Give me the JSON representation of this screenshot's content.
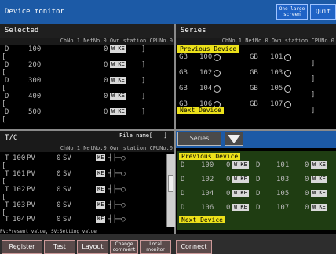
{
  "window": {
    "title": "Device monitor",
    "one_large_screen": "One large screen",
    "quit": "Quit"
  },
  "panels": {
    "selected": {
      "title": "Selected",
      "column_header": "ChNo.1 NetNo.0 Own station CPUNo.0",
      "rows": [
        {
          "dev": "D",
          "addr": "100",
          "val": "0",
          "badge": "W KE"
        },
        {
          "dev": "D",
          "addr": "200",
          "val": "0",
          "badge": "W KE"
        },
        {
          "dev": "D",
          "addr": "300",
          "val": "0",
          "badge": "W KE"
        },
        {
          "dev": "D",
          "addr": "400",
          "val": "0",
          "badge": "W KE"
        },
        {
          "dev": "D",
          "addr": "500",
          "val": "0",
          "badge": "W KE"
        }
      ]
    },
    "series": {
      "title": "Series",
      "column_header": "ChNo.1 NetNo.0 Own station CPUNo.0",
      "prev": "Previous Device",
      "next": "Next Device",
      "rows": [
        {
          "left_dev": "GB",
          "left_addr": "100",
          "right_dev": "GB",
          "right_addr": "101"
        },
        {
          "left_dev": "GB",
          "left_addr": "102",
          "right_dev": "GB",
          "right_addr": "103"
        },
        {
          "left_dev": "GB",
          "left_addr": "104",
          "right_dev": "GB",
          "right_addr": "105"
        },
        {
          "left_dev": "GB",
          "left_addr": "106",
          "right_dev": "GB",
          "right_addr": "107"
        }
      ]
    },
    "tc": {
      "title": "T/C",
      "file_name_label": "File name[",
      "column_header": "ChNo.1 NetNo.0 Own station CPUNo.0",
      "rows": [
        {
          "dev": "T",
          "addr": "100",
          "pv": "PV",
          "val": "0",
          "sv": "SV",
          "badge": "KE"
        },
        {
          "dev": "T",
          "addr": "101",
          "pv": "PV",
          "val": "0",
          "sv": "SV",
          "badge": "KE"
        },
        {
          "dev": "T",
          "addr": "102",
          "pv": "PV",
          "val": "0",
          "sv": "SV",
          "badge": "KE"
        },
        {
          "dev": "T",
          "addr": "103",
          "pv": "PV",
          "val": "0",
          "sv": "SV",
          "badge": "KE"
        },
        {
          "dev": "T",
          "addr": "104",
          "pv": "PV",
          "val": "0",
          "sv": "SV",
          "badge": "KE"
        }
      ],
      "note": "PV:Present value, SV:Setting value"
    },
    "series2": {
      "series_button": "Series",
      "prev": "Previous Device",
      "next": "Next Device",
      "rows": [
        {
          "l_dev": "D",
          "l_addr": "100",
          "l_val": "0",
          "l_badge": "W KE",
          "r_dev": "D",
          "r_addr": "101",
          "r_val": "0",
          "r_badge": "W KE"
        },
        {
          "l_dev": "D",
          "l_addr": "102",
          "l_val": "0",
          "l_badge": "W KE",
          "r_dev": "D",
          "r_addr": "103",
          "r_val": "0",
          "r_badge": "W KE"
        },
        {
          "l_dev": "D",
          "l_addr": "104",
          "l_val": "0",
          "l_badge": "W KE",
          "r_dev": "D",
          "r_addr": "105",
          "r_val": "0",
          "r_badge": "W KE"
        },
        {
          "l_dev": "D",
          "l_addr": "106",
          "l_val": "0",
          "l_badge": "W KE",
          "r_dev": "D",
          "r_addr": "107",
          "r_val": "0",
          "r_badge": "W KE"
        }
      ]
    }
  },
  "footer": {
    "register": "Register",
    "test": "Test",
    "layout": "Layout",
    "change_comment": "Change comment",
    "local_monitor": "Local monitor",
    "connect": "Connect"
  }
}
